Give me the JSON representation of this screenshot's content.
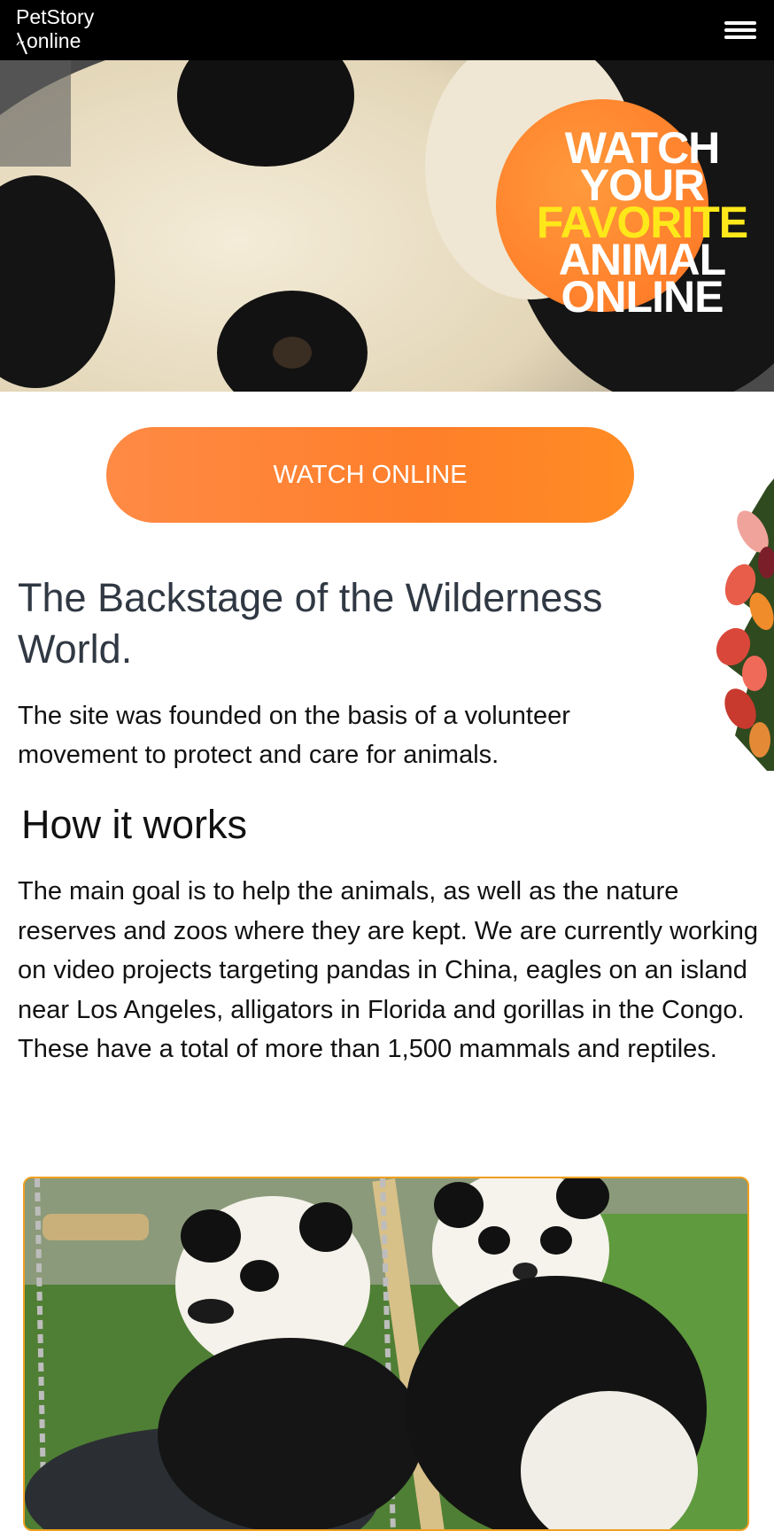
{
  "header": {
    "logo_line1": "PetStory",
    "logo_line2": "online",
    "menu_icon": "hamburger-menu-icon"
  },
  "hero": {
    "badge_line1": "WATCH",
    "badge_line2": "YOUR",
    "badge_line3": "FAVORITE",
    "badge_line4": "ANIMAL",
    "badge_line5": "ONLINE",
    "accent_color": "#ff7f2a",
    "highlight_color": "#ffe81a"
  },
  "cta": {
    "label": "WATCH ONLINE"
  },
  "content": {
    "heading": "The Backstage of the Wilderness World.",
    "intro": "The site was founded on the basis of a volunteer movement to protect and care for animals.",
    "how_heading": "How it works",
    "how_body": "The main goal is to help the animals, as well as the nature reserves and zoos where they are kept. We are currently working on video projects targeting pandas in China, eagles on an island near Los Angeles, alligators in Florida and gorillas in the Congo. These have a total of more than 1,500 mammals and reptiles."
  }
}
